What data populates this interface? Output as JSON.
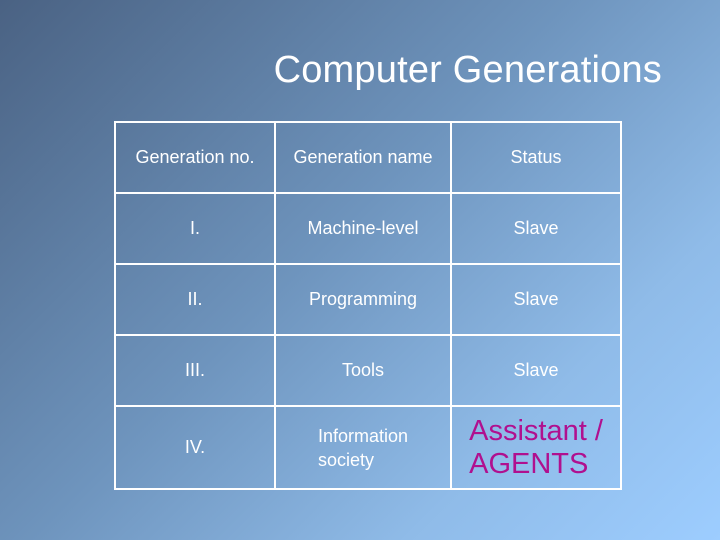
{
  "slide": {
    "title": "Computer Generations"
  },
  "table": {
    "headers": [
      "Generation no.",
      "Generation name",
      "Status"
    ],
    "rows": [
      [
        "I.",
        "Machine-level",
        "Slave"
      ],
      [
        "II.",
        "Programming",
        "Slave"
      ],
      [
        "III.",
        "Tools",
        "Slave"
      ],
      [
        "IV.",
        "Information society",
        "Assistant / AGENTS"
      ]
    ],
    "row4_name_lines": [
      "Information",
      "society"
    ],
    "row4_status_lines": [
      "Assistant /",
      "AGENTS"
    ]
  },
  "colors": {
    "background_start": "#4a6283",
    "background_end": "#9dcdff",
    "text": "#ffffff",
    "highlight": "#b0108f"
  }
}
